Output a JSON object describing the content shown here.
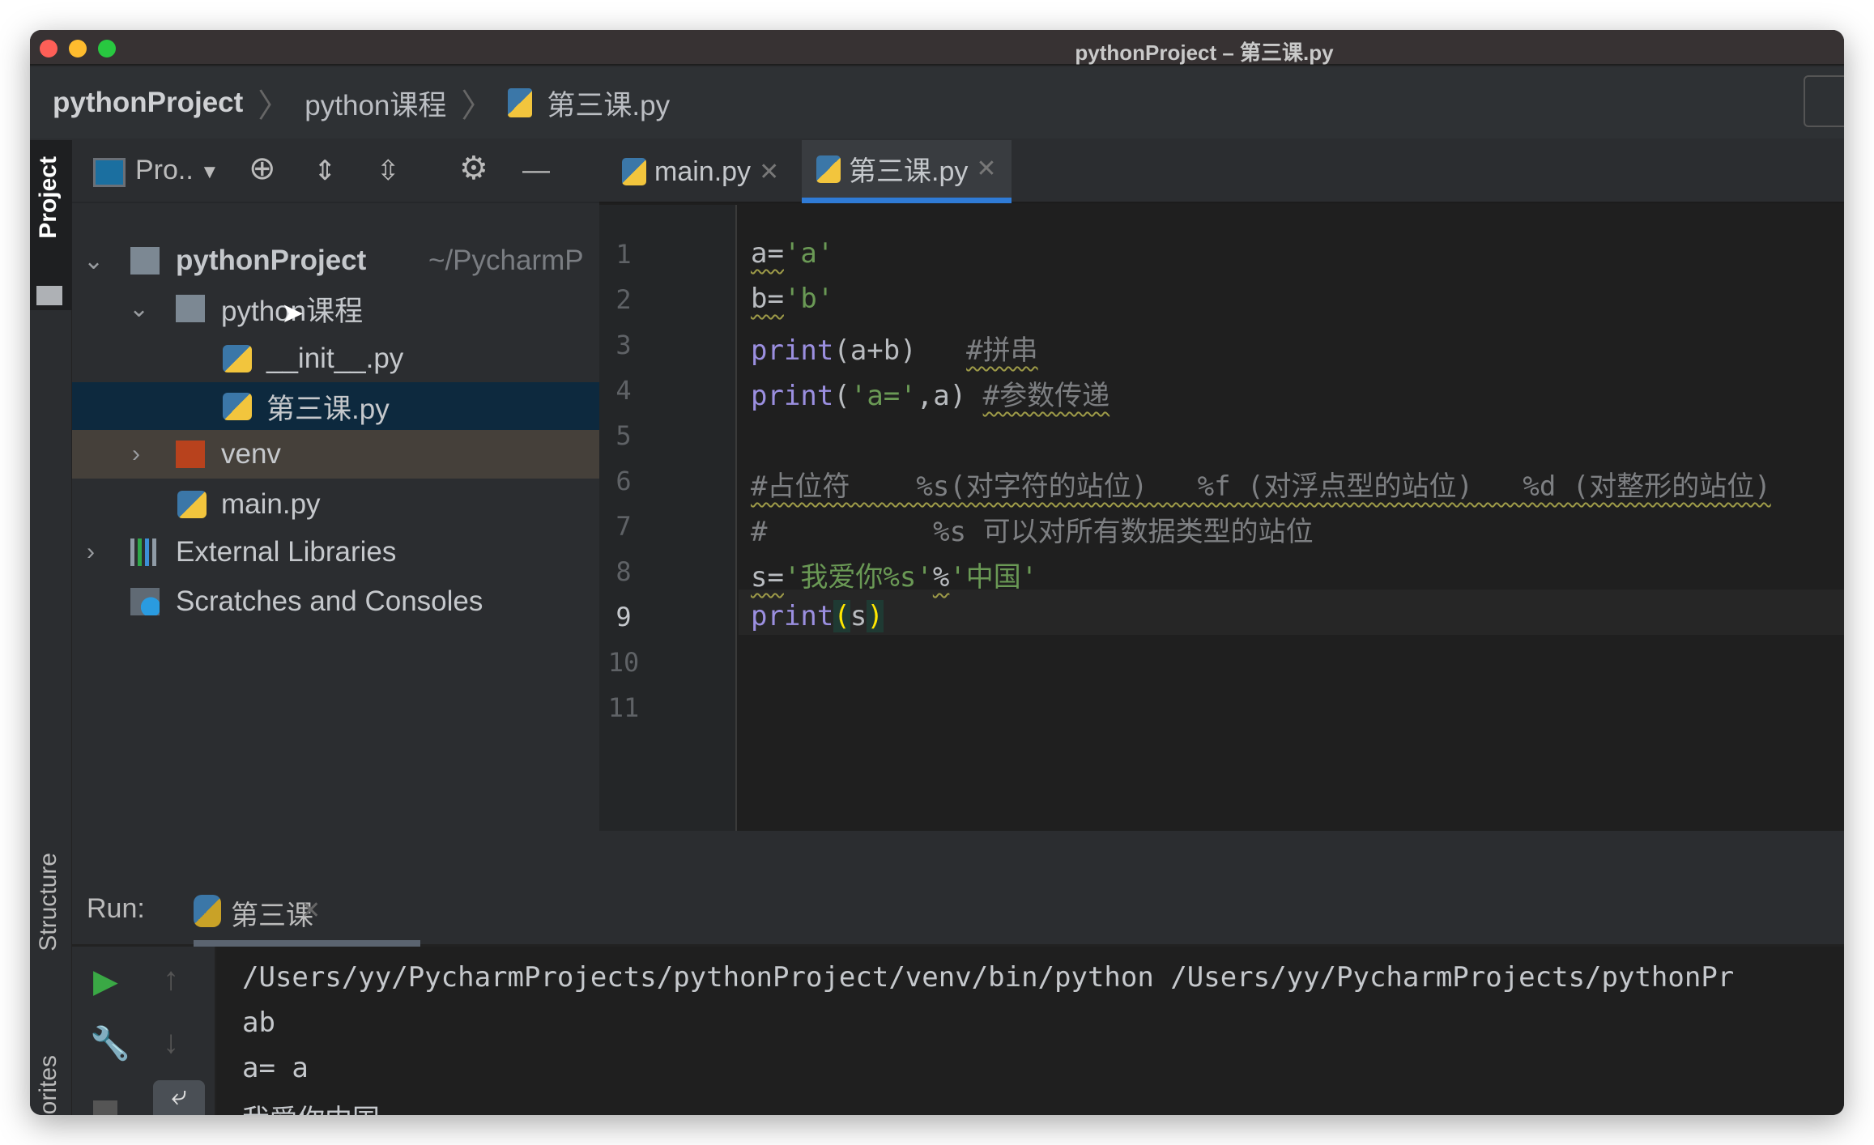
{
  "window": {
    "title": "pythonProject – 第三课.py"
  },
  "breadcrumb": [
    "pythonProject",
    "python课程",
    "第三课.py"
  ],
  "side_tabs": {
    "project": "Project",
    "structure": "Structure",
    "favorites": "orites"
  },
  "project_toolbar": {
    "view_label": "Pro..",
    "icons": [
      "locate-icon",
      "expand-all-icon",
      "collapse-all-icon",
      "gear-icon",
      "hide-icon"
    ]
  },
  "tree": [
    {
      "label": "pythonProject",
      "suffix": "~/PycharmP",
      "type": "folder",
      "expanded": true
    },
    {
      "label": "python课程",
      "type": "package",
      "expanded": true
    },
    {
      "label": "__init__.py",
      "type": "python"
    },
    {
      "label": "第三课.py",
      "type": "python",
      "selected": true
    },
    {
      "label": "venv",
      "type": "excluded-folder",
      "expanded": false
    },
    {
      "label": "main.py",
      "type": "python"
    },
    {
      "label": "External Libraries",
      "type": "libraries",
      "expanded": false
    },
    {
      "label": "Scratches and Consoles",
      "type": "scratches"
    }
  ],
  "tabs": [
    {
      "label": "main.py"
    },
    {
      "label": "第三课.py",
      "active": true
    }
  ],
  "code": {
    "line_numbers": [
      "1",
      "2",
      "3",
      "4",
      "5",
      "6",
      "7",
      "8",
      "9",
      "10",
      "11"
    ],
    "current_line": 9,
    "l1a": "a=",
    "l1b": "'a'",
    "l2a": "b=",
    "l2b": "'b'",
    "l3a": "print",
    "l3b": "(a+b)   ",
    "l3c": "#拼串",
    "l4a": "print",
    "l4b": "(",
    "l4c": "'a='",
    "l4d": ",a) ",
    "l4e": "#参数传递",
    "l6": "#占位符    %s(对字符的站位)   %f (对浮点型的站位)   %d (对整形的站位)",
    "l7": "#          %s 可以对所有数据类型的站位",
    "l8a": "s=",
    "l8b": "'我爱你%s'",
    "l8c": "%",
    "l8d": "'中国'",
    "l9a": "print",
    "l9b": "(",
    "l9c": "s",
    "l9d": ")"
  },
  "run": {
    "label": "Run:",
    "tab": "第三课",
    "output": [
      "/Users/yy/PycharmProjects/pythonProject/venv/bin/python /Users/yy/PycharmProjects/pythonPr",
      "ab",
      "a= a",
      "我爱你中国"
    ]
  },
  "colors": {
    "accent": "#2f7bd6",
    "selection": "#0d293e",
    "venv_row": "#45403a",
    "keyword": "#9b8fe0",
    "string": "#6a9955",
    "run_green": "#3aa845"
  }
}
